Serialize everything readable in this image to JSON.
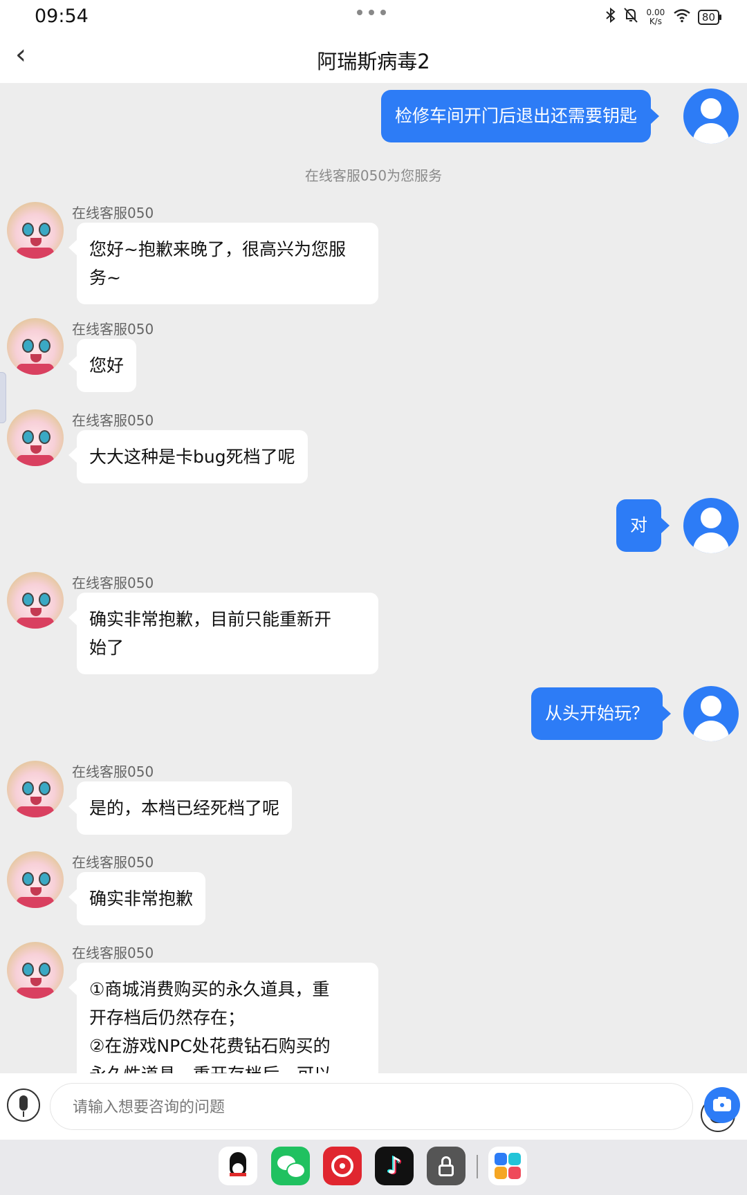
{
  "status_bar": {
    "time": "09:54",
    "net_speed_value": "0.00",
    "net_speed_unit": "K/s",
    "battery": "80",
    "icons": [
      "bluetooth-icon",
      "mute-icon",
      "wifi-icon",
      "battery-icon"
    ]
  },
  "header": {
    "back_icon": "chevron-left-icon",
    "title": "阿瑞斯病毒2"
  },
  "chat": {
    "system_note": "在线客服050为您服务",
    "messages": [
      {
        "from": "user",
        "text": "检修车间开门后退出还需要钥匙"
      },
      {
        "from": "agent",
        "name": "在线客服050",
        "lines": [
          "您好~抱歉来晚了，很高兴为您服",
          "务~"
        ]
      },
      {
        "from": "agent",
        "name": "在线客服050",
        "lines": [
          "您好"
        ]
      },
      {
        "from": "agent",
        "name": "在线客服050",
        "lines": [
          "大大这种是卡bug死档了呢"
        ]
      },
      {
        "from": "user",
        "text": "对"
      },
      {
        "from": "agent",
        "name": "在线客服050",
        "lines": [
          "确实非常抱歉，目前只能重新开",
          "始了"
        ]
      },
      {
        "from": "user",
        "text": "从头开始玩？"
      },
      {
        "from": "agent",
        "name": "在线客服050",
        "lines": [
          "是的，本档已经死档了呢"
        ]
      },
      {
        "from": "agent",
        "name": "在线客服050",
        "lines": [
          "确实非常抱歉"
        ]
      },
      {
        "from": "agent",
        "name": "在线客服050",
        "lines": [
          "①商城消费购买的永久道具，重",
          "开存档后仍然存在；",
          "②在游戏NPC处花费钻石购买的",
          "永久性道具，重开存档后，可以"
        ]
      }
    ]
  },
  "input_bar": {
    "placeholder": "请输入想要咨询的问题",
    "mic_icon": "microphone-icon",
    "emoji_icon": "emoji-icon",
    "camera_icon": "camera-icon"
  },
  "dock": {
    "apps": [
      "qq-app-icon",
      "wechat-app-icon",
      "netease-music-app-icon",
      "tiktok-app-icon",
      "lock-app-icon",
      "app-library-icon"
    ],
    "tiktok_glyph": "♪"
  },
  "colors": {
    "accent": "#2d7cf6",
    "chat_background": "#ededed",
    "agent_bubble": "#ffffff"
  }
}
